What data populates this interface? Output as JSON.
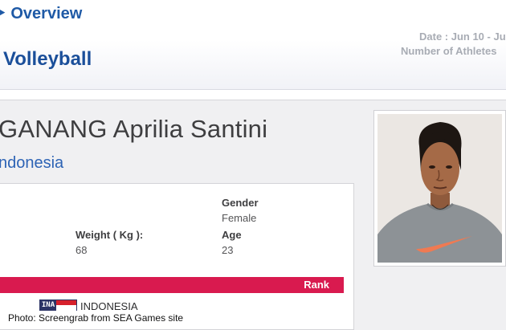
{
  "header": {
    "overview_title": "‣ Overview",
    "sport_title": "Volleyball",
    "date": "Date : Jun 10 - Ju",
    "athletes": "Number of Athletes"
  },
  "athlete": {
    "name": "GANANG Aprilia Santini",
    "country": "ndonesia",
    "gender_label": "Gender",
    "gender_value": "Female",
    "weight_label": "Weight ( Kg ):",
    "weight_value": "68",
    "age_label": "Age",
    "age_value": "23"
  },
  "results": {
    "rank_label": "Rank",
    "flag_code": "INA",
    "country_name": "INDONESIA"
  },
  "photo": {
    "icon": "athlete-portrait",
    "background": "#e6e3de",
    "shirt_color": "#8d9296",
    "swoosh_color": "#f07a52"
  },
  "credit": "Photo: Screengrab from SEA Games site",
  "colors": {
    "accent_blue": "#1f5aa6",
    "rank_bar": "#d91a4f"
  }
}
